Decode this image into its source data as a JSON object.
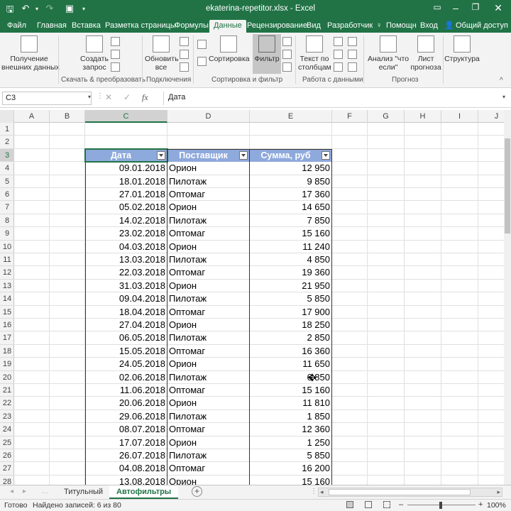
{
  "window": {
    "title": "ekaterina-repetitor.xlsx - Excel"
  },
  "ribbon_tabs": {
    "file": "Файл",
    "home": "Главная",
    "insert": "Вставка",
    "page_layout": "Разметка страницы",
    "formulas": "Формулы",
    "data": "Данные",
    "review": "Рецензирование",
    "view": "Вид",
    "developer": "Разработчик",
    "help": "Помощн",
    "signin": "Вход",
    "share": "Общий доступ"
  },
  "ribbon": {
    "get_external": "Получение",
    "get_external2": "внешних данных",
    "new_query": "Создать",
    "new_query2": "запрос",
    "refresh": "Обновить",
    "refresh2": "все",
    "sort": "Сортировка",
    "filter": "Фильтр",
    "text_to_columns": "Текст по",
    "text_to_columns2": "столбцам",
    "whatif": "Анализ \"что",
    "whatif2": "если\"",
    "forecast": "Лист",
    "forecast2": "прогноза",
    "outline": "Структура",
    "group_get": "Скачать & преобразовать",
    "group_conn": "Подключения",
    "group_sort": "Сортировка и фильтр",
    "group_data": "Работа с данными",
    "group_forecast": "Прогноз"
  },
  "formula_bar": {
    "name_box": "C3",
    "fx": "fx",
    "content": "Дата"
  },
  "columns": [
    "A",
    "B",
    "C",
    "D",
    "E",
    "F",
    "G",
    "H",
    "I",
    "J"
  ],
  "rows": [
    "1",
    "2",
    "3",
    "4",
    "5",
    "6",
    "7",
    "8",
    "9",
    "10",
    "11",
    "12",
    "13",
    "14",
    "15",
    "16",
    "17",
    "18",
    "19",
    "20",
    "21",
    "22",
    "23",
    "24",
    "25",
    "26",
    "27",
    "28"
  ],
  "table": {
    "headers": [
      "Дата",
      "Поставщик",
      "Сумма, руб"
    ],
    "rows": [
      [
        "09.01.2018",
        "Орион",
        "12 950"
      ],
      [
        "18.01.2018",
        "Пилотаж",
        "9 850"
      ],
      [
        "27.01.2018",
        "Оптомаг",
        "17 360"
      ],
      [
        "05.02.2018",
        "Орион",
        "14 650"
      ],
      [
        "14.02.2018",
        "Пилотаж",
        "7 850"
      ],
      [
        "23.02.2018",
        "Оптомаг",
        "15 160"
      ],
      [
        "04.03.2018",
        "Орион",
        "11 240"
      ],
      [
        "13.03.2018",
        "Пилотаж",
        "4 850"
      ],
      [
        "22.03.2018",
        "Оптомаг",
        "19 360"
      ],
      [
        "31.03.2018",
        "Орион",
        "21 950"
      ],
      [
        "09.04.2018",
        "Пилотаж",
        "5 850"
      ],
      [
        "18.04.2018",
        "Оптомаг",
        "17 900"
      ],
      [
        "27.04.2018",
        "Орион",
        "18 250"
      ],
      [
        "06.05.2018",
        "Пилотаж",
        "2 850"
      ],
      [
        "15.05.2018",
        "Оптомаг",
        "16 360"
      ],
      [
        "24.05.2018",
        "Орион",
        "11 650"
      ],
      [
        "02.06.2018",
        "Пилотаж",
        "6 850"
      ],
      [
        "11.06.2018",
        "Оптомаг",
        "15 160"
      ],
      [
        "20.06.2018",
        "Орион",
        "11 810"
      ],
      [
        "29.06.2018",
        "Пилотаж",
        "1 850"
      ],
      [
        "08.07.2018",
        "Оптомаг",
        "12 360"
      ],
      [
        "17.07.2018",
        "Орион",
        "1 250"
      ],
      [
        "26.07.2018",
        "Пилотаж",
        "5 850"
      ],
      [
        "04.08.2018",
        "Оптомаг",
        "16 200"
      ],
      [
        "13.08.2018",
        "Орион",
        "15 160"
      ]
    ]
  },
  "sheets": {
    "tab1": "Титульный",
    "tab2": "Автофильтры"
  },
  "status_bar": {
    "ready": "Готово",
    "records": "Найдено записей: 6 из 80",
    "zoom": "100%"
  },
  "colors": {
    "excel_green": "#217346",
    "table_header": "#8ea9db"
  }
}
